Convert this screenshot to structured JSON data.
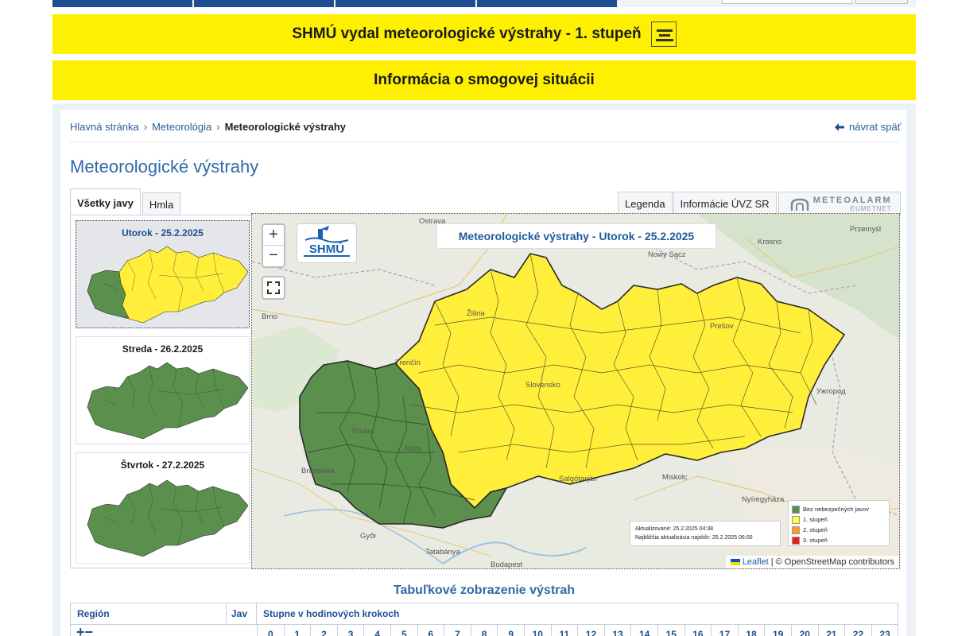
{
  "banners": {
    "warning": "SHMÚ vydal meteorologické výstrahy - 1. stupeň",
    "smog": "Informácia o smogovej situácii"
  },
  "breadcrumb": {
    "home": "Hlavná stránka",
    "section": "Meteorológia",
    "current": "Meteorologické výstrahy",
    "back": "návrat späť"
  },
  "page_title": "Meteorologické výstrahy",
  "tabs": {
    "all": "Všetky javy",
    "fog": "Hmla",
    "legend": "Legenda",
    "uvz": "Informácie ÚVZ SR",
    "meteoalarm_top": "METEOALARM",
    "meteoalarm_bottom": "EUMETNET"
  },
  "days": [
    {
      "label": "Utorok - 25.2.2025",
      "selected": true
    },
    {
      "label": "Streda - 26.2.2025",
      "selected": false
    },
    {
      "label": "Štvrtok - 27.2.2025",
      "selected": false
    }
  ],
  "map": {
    "title": "Meteorologické výstrahy - Utorok - 25.2.2025",
    "zoom_in": "+",
    "zoom_out": "−",
    "updated": "Aktualizované: 25.2.2025 04:38",
    "next_update": "Najbližšia aktualizácia najskôr: 25.2.2025 06:00",
    "attribution_leaflet": "Leaflet",
    "attribution_rest": "| © OpenStreetMap contributors",
    "legend": [
      {
        "label": "Bez nebezpečných javov",
        "color": "#5a8f4e"
      },
      {
        "label": "1. stupeň",
        "color": "#ffff33"
      },
      {
        "label": "2. stupeň",
        "color": "#ff9a1f"
      },
      {
        "label": "3. stupeň",
        "color": "#ee1c1c"
      }
    ],
    "cities": [
      "Ostrava",
      "Nowy Sącz",
      "Krosno",
      "Przemyśl",
      "Brno",
      "Žilina",
      "Trenčín",
      "Prešov",
      "Slovensko",
      "Trnava",
      "Nitra",
      "Salgótarján",
      "Miskolc",
      "Nyíregyháza",
      "Győr",
      "Tatabánya",
      "Budapest",
      "Bratislava",
      "Ужгород"
    ]
  },
  "table": {
    "title": "Tabuľkové zobrazenie výstrah",
    "col_region": "Región",
    "col_phenomenon": "Jav",
    "col_hours": "Stupne v hodinových krokoch",
    "expand": "+−",
    "hours": [
      "0",
      "1",
      "2",
      "3",
      "4",
      "5",
      "6",
      "7",
      "8",
      "9",
      "10",
      "11",
      "12",
      "13",
      "14",
      "15",
      "16",
      "17",
      "18",
      "19",
      "20",
      "21",
      "22",
      "23"
    ]
  },
  "colors": {
    "banner": "#ffef00",
    "green": "#5a8f4e",
    "yellow": "#ffef3a",
    "link": "#2c5a9a"
  }
}
